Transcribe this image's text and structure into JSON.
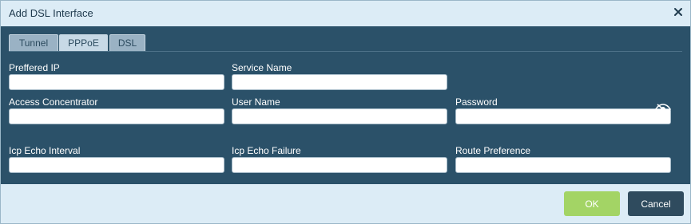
{
  "dialog": {
    "title": "Add DSL Interface",
    "close_icon": "close-icon"
  },
  "tabs": [
    {
      "label": "Tunnel",
      "active": false
    },
    {
      "label": "PPPoE",
      "active": true
    },
    {
      "label": "DSL",
      "active": false
    }
  ],
  "fields": {
    "preferred_ip": {
      "label": "Preffered IP",
      "value": ""
    },
    "service_name": {
      "label": "Service Name",
      "value": ""
    },
    "access_concentrator": {
      "label": "Access Concentrator",
      "value": ""
    },
    "user_name": {
      "label": "User Name",
      "value": ""
    },
    "password": {
      "label": "Password",
      "value": "",
      "toggle_icon": "eye-icon"
    },
    "lcp_echo_interval": {
      "label": "Icp Echo Interval",
      "value": ""
    },
    "lcp_echo_failure": {
      "label": "Icp Echo Failure",
      "value": ""
    },
    "route_preference": {
      "label": "Route Preference",
      "value": ""
    }
  },
  "buttons": {
    "ok": "OK",
    "cancel": "Cancel"
  },
  "colors": {
    "panel": "#2b5169",
    "chrome": "#dcecf6",
    "ok": "#a3d465",
    "cancel": "#2f4b5e"
  }
}
